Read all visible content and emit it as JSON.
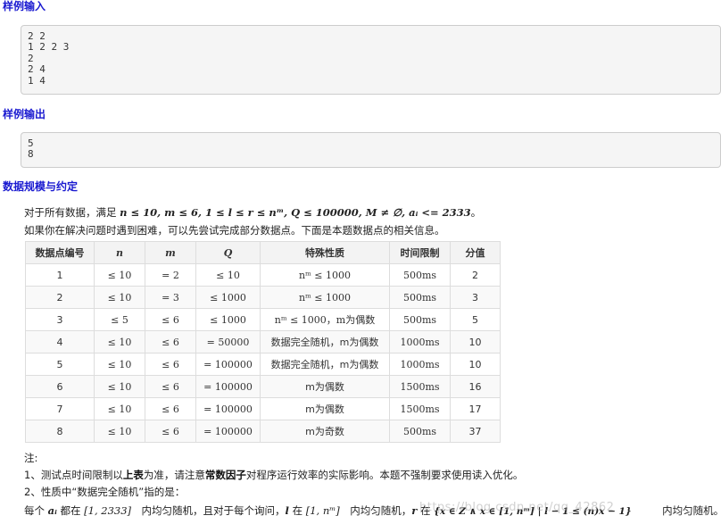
{
  "sample_input": {
    "heading": "样例输入",
    "lines": [
      "2 2",
      "1 2 2 3",
      "2",
      "2 4",
      "1 4"
    ]
  },
  "sample_output": {
    "heading": "样例输出",
    "lines": [
      "5",
      "8"
    ]
  },
  "constraints": {
    "heading": "数据规模与约定",
    "line1_prefix": "对于所有数据，满足 ",
    "line1_math": "n ≤ 10, m ≤ 6, 1 ≤ l ≤ r ≤ nᵐ, Q ≤ 100000, M ≠ ∅, aᵢ <= 2333",
    "line1_suffix": "。",
    "line2": "如果你在解决问题时遇到困难，可以先尝试完成部分数据点。下面是本题数据点的相关信息。"
  },
  "table": {
    "headers": [
      "数据点编号",
      "n",
      "m",
      "Q",
      "特殊性质",
      "时间限制",
      "分值"
    ],
    "rows": [
      [
        "1",
        "≤ 10",
        "= 2",
        "≤ 10",
        "nᵐ ≤ 1000",
        "500ms",
        "2"
      ],
      [
        "2",
        "≤ 10",
        "= 3",
        "≤ 1000",
        "nᵐ ≤ 1000",
        "500ms",
        "3"
      ],
      [
        "3",
        "≤ 5",
        "≤ 6",
        "≤ 1000",
        "nᵐ ≤ 1000，m为偶数",
        "500ms",
        "5"
      ],
      [
        "4",
        "≤ 10",
        "≤ 6",
        "= 50000",
        "数据完全随机，m为偶数",
        "1000ms",
        "10"
      ],
      [
        "5",
        "≤ 10",
        "≤ 6",
        "= 100000",
        "数据完全随机，m为偶数",
        "1000ms",
        "10"
      ],
      [
        "6",
        "≤ 10",
        "≤ 6",
        "= 100000",
        "m为偶数",
        "1500ms",
        "16"
      ],
      [
        "7",
        "≤ 10",
        "≤ 6",
        "= 100000",
        "m为偶数",
        "1500ms",
        "17"
      ],
      [
        "8",
        "≤ 10",
        "≤ 6",
        "= 100000",
        "m为奇数",
        "500ms",
        "37"
      ]
    ]
  },
  "notes": {
    "title": "注:",
    "note1_a": "1、测试点时间限制以",
    "note1_b": "上表",
    "note1_c": "为准，请注意",
    "note1_d": "常数因子",
    "note1_e": "对程序运行效率的实际影响。本题不强制要求使用读入优化。",
    "note2": "2、性质中“数据完全随机”指的是：",
    "note3_a": "每个 ",
    "note3_b": "aᵢ",
    "note3_c": " 都在 ",
    "note3_d": "[1, 2333]",
    "note3_e": "　内均匀随机，且对于每个询问，",
    "note3_f": "l",
    "note3_g": " 在 ",
    "note3_h": "[1, nᵐ]",
    "note3_i": "　内均匀随机，",
    "note3_j": "r",
    "note3_k": " 在 ",
    "note3_l": "{x ∈ Z ∧ x ∈ [1, nᵐ] | l − 1 ≤ (n)x − 1}",
    "note3_m": "　　　内均匀随机。"
  },
  "watermark": "https://blog.csdn.net/qq_42862"
}
